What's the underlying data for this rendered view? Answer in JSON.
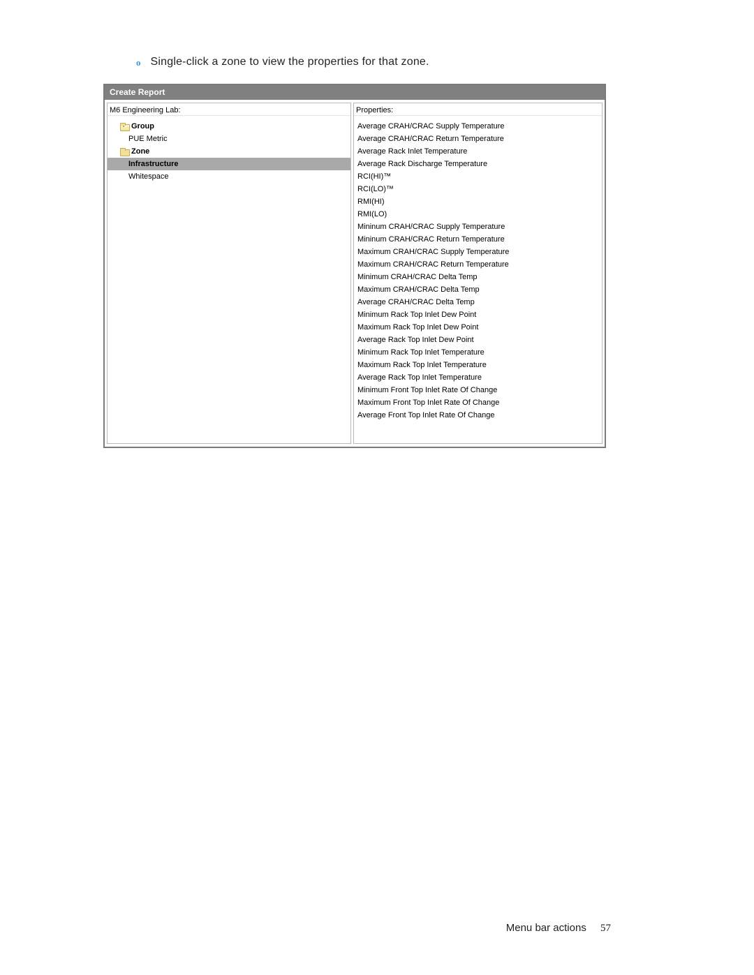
{
  "instruction": {
    "bullet": "o",
    "text": "Single-click a zone to view the properties for that zone."
  },
  "dialog": {
    "title": "Create Report",
    "leftHeader": "M6 Engineering Lab:",
    "rightHeader": "Properties:",
    "tree": {
      "group": "Group",
      "pue": "PUE Metric",
      "zone": "Zone",
      "infra": "Infrastructure",
      "white": "Whitespace"
    },
    "properties": [
      "Average CRAH/CRAC Supply Temperature",
      "Average CRAH/CRAC Return Temperature",
      "Average Rack Inlet Temperature",
      "Average Rack Discharge Temperature",
      "RCI(HI)™",
      "RCI(LO)™",
      "RMI(HI)",
      "RMI(LO)",
      "Mininum CRAH/CRAC Supply Temperature",
      "Mininum CRAH/CRAC Return Temperature",
      "Maximum CRAH/CRAC Supply Temperature",
      "Maximum CRAH/CRAC Return Temperature",
      "Minimum CRAH/CRAC Delta Temp",
      "Maximum CRAH/CRAC Delta Temp",
      "Average CRAH/CRAC Delta Temp",
      "Minimum Rack Top Inlet Dew Point",
      "Maximum Rack Top Inlet Dew Point",
      "Average Rack Top Inlet Dew Point",
      "Minimum Rack Top Inlet Temperature",
      "Maximum Rack Top Inlet Temperature",
      "Average Rack Top Inlet Temperature",
      "Minimum Front Top Inlet Rate Of Change",
      "Maximum Front Top Inlet Rate Of Change",
      "Average Front Top Inlet Rate Of Change"
    ]
  },
  "footer": {
    "section": "Menu bar actions",
    "page": "57"
  }
}
